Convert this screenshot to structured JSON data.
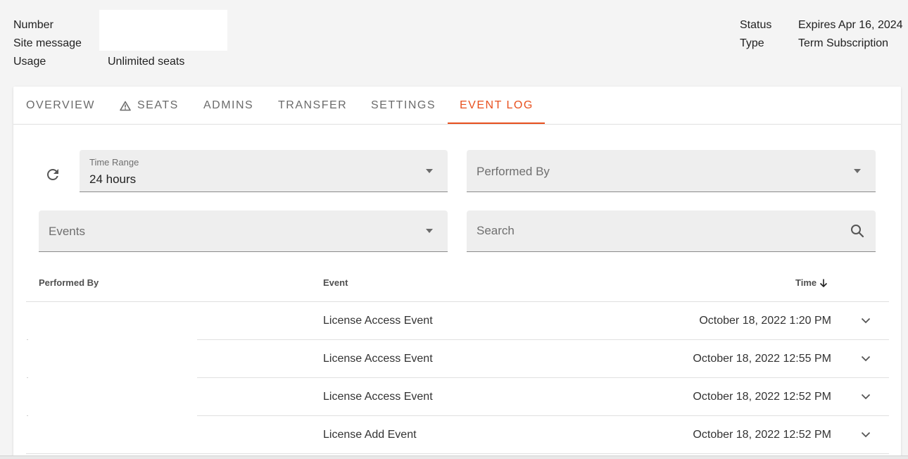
{
  "header": {
    "left": {
      "number_label": "Number",
      "site_message_label": "Site message",
      "usage_label": "Usage",
      "usage_value": "Unlimited seats"
    },
    "right": {
      "status_label": "Status",
      "status_value": "Expires Apr 16, 2024",
      "type_label": "Type",
      "type_value": "Term Subscription"
    }
  },
  "tabs": [
    {
      "label": "OVERVIEW"
    },
    {
      "label": "SEATS",
      "icon": "warning-icon"
    },
    {
      "label": "ADMINS"
    },
    {
      "label": "TRANSFER"
    },
    {
      "label": "SETTINGS"
    },
    {
      "label": "EVENT LOG",
      "active": true
    }
  ],
  "filters": {
    "time_range_label": "Time Range",
    "time_range_value": "24 hours",
    "performed_by_placeholder": "Performed By",
    "events_placeholder": "Events",
    "search_placeholder": "Search"
  },
  "table": {
    "columns": {
      "performed_by": "Performed By",
      "event": "Event",
      "time": "Time"
    },
    "rows": [
      {
        "event": "License Access Event",
        "time": "October 18, 2022 1:20 PM"
      },
      {
        "event": "License Access Event",
        "time": "October 18, 2022 12:55 PM"
      },
      {
        "event": "License Access Event",
        "time": "October 18, 2022 12:52 PM"
      },
      {
        "event": "License Add Event",
        "time": "October 18, 2022 12:52 PM"
      }
    ]
  },
  "colors": {
    "accent": "#e8501e",
    "background": "#f4f4f4",
    "field_bg": "#eeeeee"
  }
}
